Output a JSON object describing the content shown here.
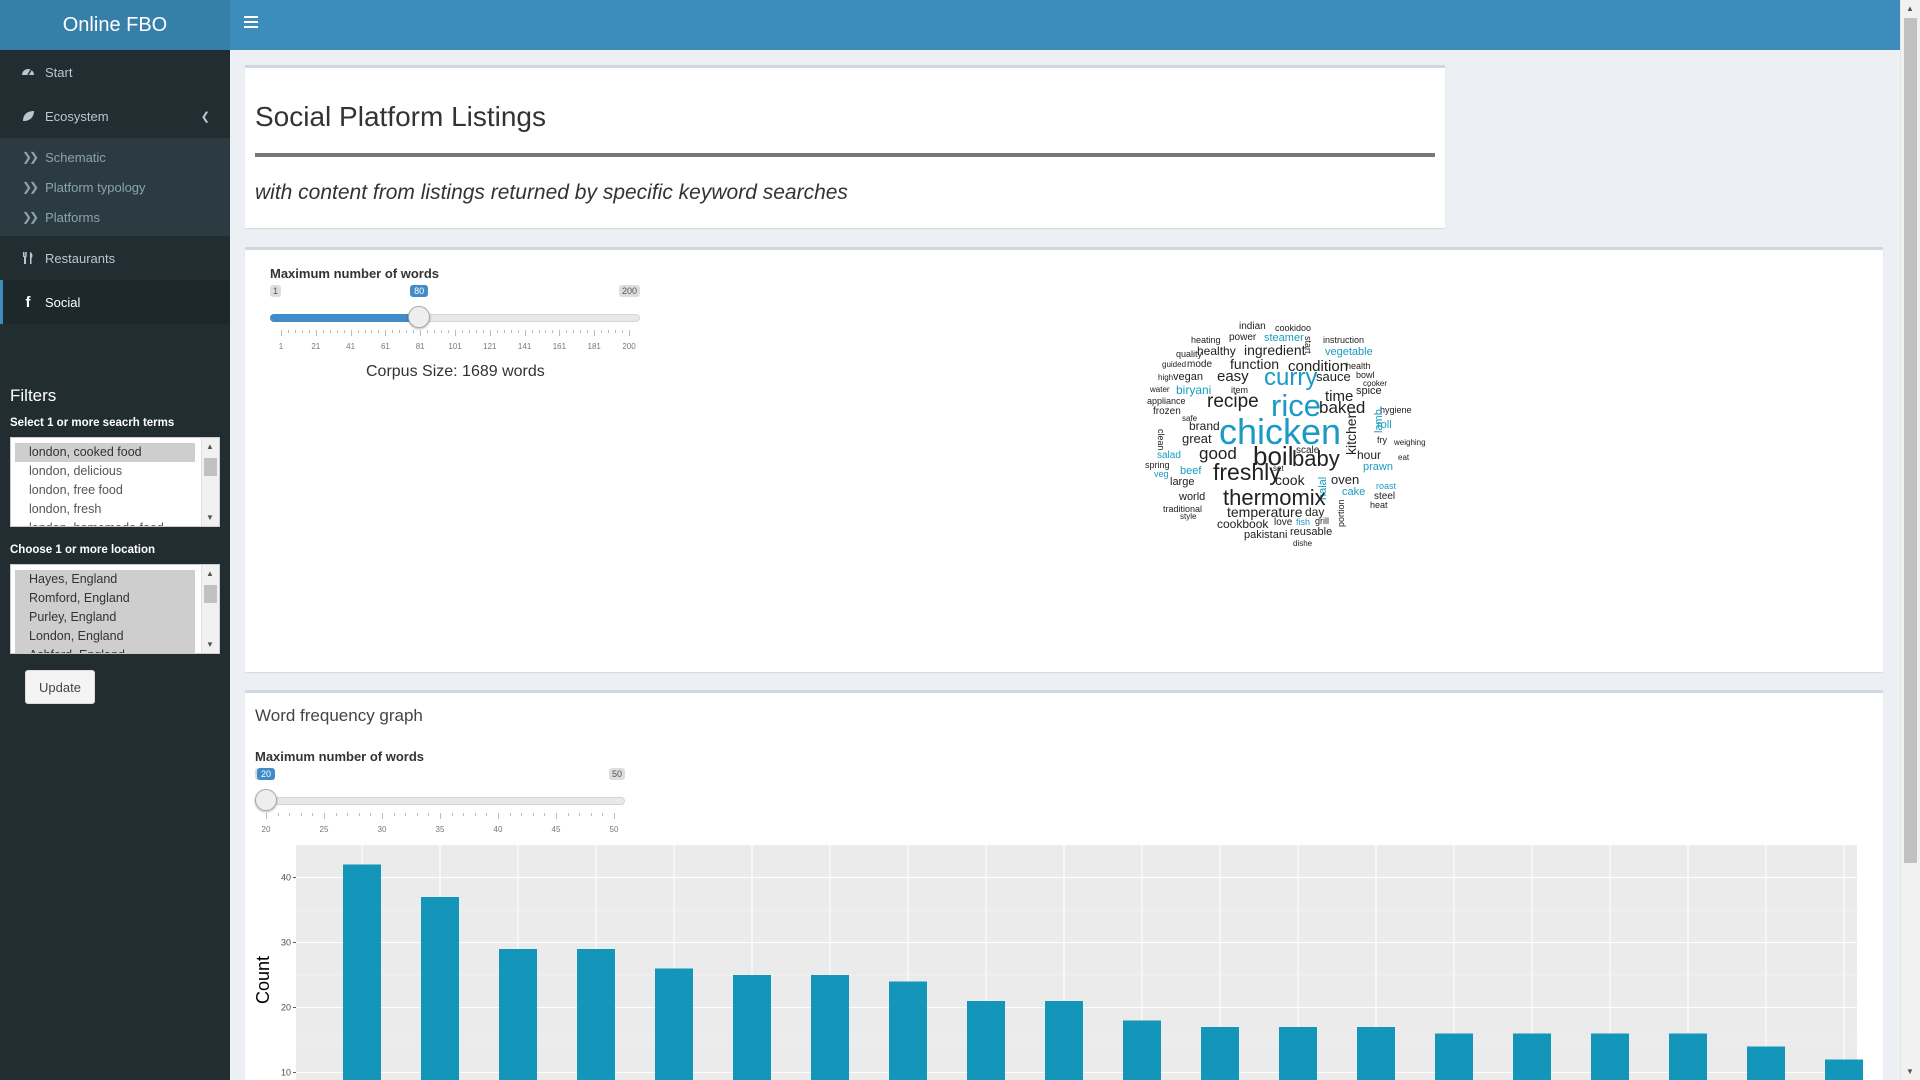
{
  "header": {
    "logo": "Online FBO"
  },
  "sidebar": {
    "items": [
      {
        "label": "Start",
        "icon": "dashboard-icon"
      },
      {
        "label": "Ecosystem",
        "icon": "leaf-icon"
      },
      {
        "label": "Restaurants",
        "icon": "cutlery-icon"
      },
      {
        "label": "Social",
        "icon": "facebook-icon"
      }
    ],
    "sub_items": [
      "Schematic",
      "Platform typology",
      "Platforms"
    ]
  },
  "filters": {
    "title": "Filters",
    "search_label": "Select 1 or more seacrh terms",
    "search_options": [
      "london, cooked food",
      "london, delicious",
      "london, free food",
      "london, fresh",
      "london, homemade food"
    ],
    "location_label": "Choose 1 or more location",
    "location_options": [
      "Hayes, England",
      "Romford, England",
      "Purley, England",
      "London, England",
      "Ashford, England"
    ],
    "update_label": "Update"
  },
  "header_box": {
    "title": "Social Platform Listings",
    "subtitle": "with content from listings returned by specific keyword searches"
  },
  "wordcloud_box": {
    "slider_label": "Maximum number of words",
    "slider": {
      "min": 1,
      "max": 200,
      "value": 80,
      "min_label": "1",
      "max_label": "200",
      "value_label": "80",
      "tick_labels": [
        "1",
        "21",
        "41",
        "61",
        "81",
        "101",
        "121",
        "141",
        "161",
        "181",
        "200"
      ]
    },
    "corpus_text": "Corpus Size: 1689 words",
    "words": [
      {
        "t": "indian",
        "c": "#222"
      },
      {
        "t": "cookidoo",
        "c": "#222"
      },
      {
        "t": "power",
        "c": "#222"
      },
      {
        "t": "steamer",
        "c": "#1a9ac4"
      },
      {
        "t": "heating",
        "c": "#222"
      },
      {
        "t": "start",
        "c": "#222"
      },
      {
        "t": "instruction",
        "c": "#222"
      },
      {
        "t": "healthy",
        "c": "#222"
      },
      {
        "t": "ingredient",
        "c": "#222"
      },
      {
        "t": "vegetable",
        "c": "#1a9ac4"
      },
      {
        "t": "quality",
        "c": "#222"
      },
      {
        "t": "guided",
        "c": "#222"
      },
      {
        "t": "mode",
        "c": "#222"
      },
      {
        "t": "function",
        "c": "#222"
      },
      {
        "t": "condition",
        "c": "#222"
      },
      {
        "t": "health",
        "c": "#222"
      },
      {
        "t": "high",
        "c": "#222"
      },
      {
        "t": "vegan",
        "c": "#222"
      },
      {
        "t": "easy",
        "c": "#222"
      },
      {
        "t": "curry",
        "c": "#1a9ac4"
      },
      {
        "t": "sauce",
        "c": "#222"
      },
      {
        "t": "bowl",
        "c": "#222"
      },
      {
        "t": "cooker",
        "c": "#222"
      },
      {
        "t": "water",
        "c": "#222"
      },
      {
        "t": "biryani",
        "c": "#1a9ac4"
      },
      {
        "t": "item",
        "c": "#222"
      },
      {
        "t": "spice",
        "c": "#222"
      },
      {
        "t": "time",
        "c": "#222"
      },
      {
        "t": "appliance",
        "c": "#222"
      },
      {
        "t": "recipe",
        "c": "#222"
      },
      {
        "t": "rice",
        "c": "#1a9ac4"
      },
      {
        "t": "frozen",
        "c": "#222"
      },
      {
        "t": "baked",
        "c": "#222"
      },
      {
        "t": "hygiene",
        "c": "#222"
      },
      {
        "t": "safe",
        "c": "#222"
      },
      {
        "t": "clean",
        "c": "#222"
      },
      {
        "t": "brand",
        "c": "#222"
      },
      {
        "t": "chicken",
        "c": "#1a9ac4"
      },
      {
        "t": "kitchen",
        "c": "#222"
      },
      {
        "t": "lamb",
        "c": "#1a9ac4"
      },
      {
        "t": "roll",
        "c": "#1a9ac4"
      },
      {
        "t": "great",
        "c": "#222"
      },
      {
        "t": "fry",
        "c": "#222"
      },
      {
        "t": "weighing",
        "c": "#222"
      },
      {
        "t": "salad",
        "c": "#1a9ac4"
      },
      {
        "t": "good",
        "c": "#222"
      },
      {
        "t": "boil",
        "c": "#222"
      },
      {
        "t": "scale",
        "c": "#222"
      },
      {
        "t": "hour",
        "c": "#222"
      },
      {
        "t": "eat",
        "c": "#222"
      },
      {
        "t": "spring",
        "c": "#222"
      },
      {
        "t": "baby",
        "c": "#222"
      },
      {
        "t": "veg",
        "c": "#1a9ac4"
      },
      {
        "t": "beef",
        "c": "#1a9ac4"
      },
      {
        "t": "freshly",
        "c": "#222"
      },
      {
        "t": "set",
        "c": "#222"
      },
      {
        "t": "prawn",
        "c": "#1a9ac4"
      },
      {
        "t": "large",
        "c": "#222"
      },
      {
        "t": "cook",
        "c": "#222"
      },
      {
        "t": "oven",
        "c": "#222"
      },
      {
        "t": "roast",
        "c": "#1a9ac4"
      },
      {
        "t": "halal",
        "c": "#1a9ac4"
      },
      {
        "t": "world",
        "c": "#222"
      },
      {
        "t": "thermomix",
        "c": "#222"
      },
      {
        "t": "cake",
        "c": "#1a9ac4"
      },
      {
        "t": "steel",
        "c": "#222"
      },
      {
        "t": "traditional",
        "c": "#222"
      },
      {
        "t": "temperature",
        "c": "#222"
      },
      {
        "t": "day",
        "c": "#222"
      },
      {
        "t": "heat",
        "c": "#222"
      },
      {
        "t": "style",
        "c": "#222"
      },
      {
        "t": "portion",
        "c": "#222"
      },
      {
        "t": "cookbook",
        "c": "#222"
      },
      {
        "t": "love",
        "c": "#222"
      },
      {
        "t": "fish",
        "c": "#1a9ac4"
      },
      {
        "t": "grill",
        "c": "#222"
      },
      {
        "t": "pakistani",
        "c": "#222"
      },
      {
        "t": "reusable",
        "c": "#222"
      },
      {
        "t": "dishe",
        "c": "#222"
      }
    ]
  },
  "freq_box": {
    "title": "Word frequency graph",
    "slider_label": "Maximum number of words",
    "slider": {
      "min": 20,
      "max": 50,
      "value": 20,
      "min_label": "20",
      "max_label": "50",
      "value_label": "20",
      "tick_labels": [
        "20",
        "25",
        "30",
        "35",
        "40",
        "45",
        "50"
      ]
    }
  },
  "chart_data": {
    "type": "bar",
    "ylabel": "Count",
    "yticks": [
      10,
      20,
      30,
      40
    ],
    "values": [
      42,
      37,
      29,
      29,
      26,
      25,
      25,
      24,
      21,
      21,
      18,
      17,
      17,
      17,
      16,
      16,
      16,
      16,
      14,
      12
    ],
    "bar_color": "#1496bb"
  }
}
